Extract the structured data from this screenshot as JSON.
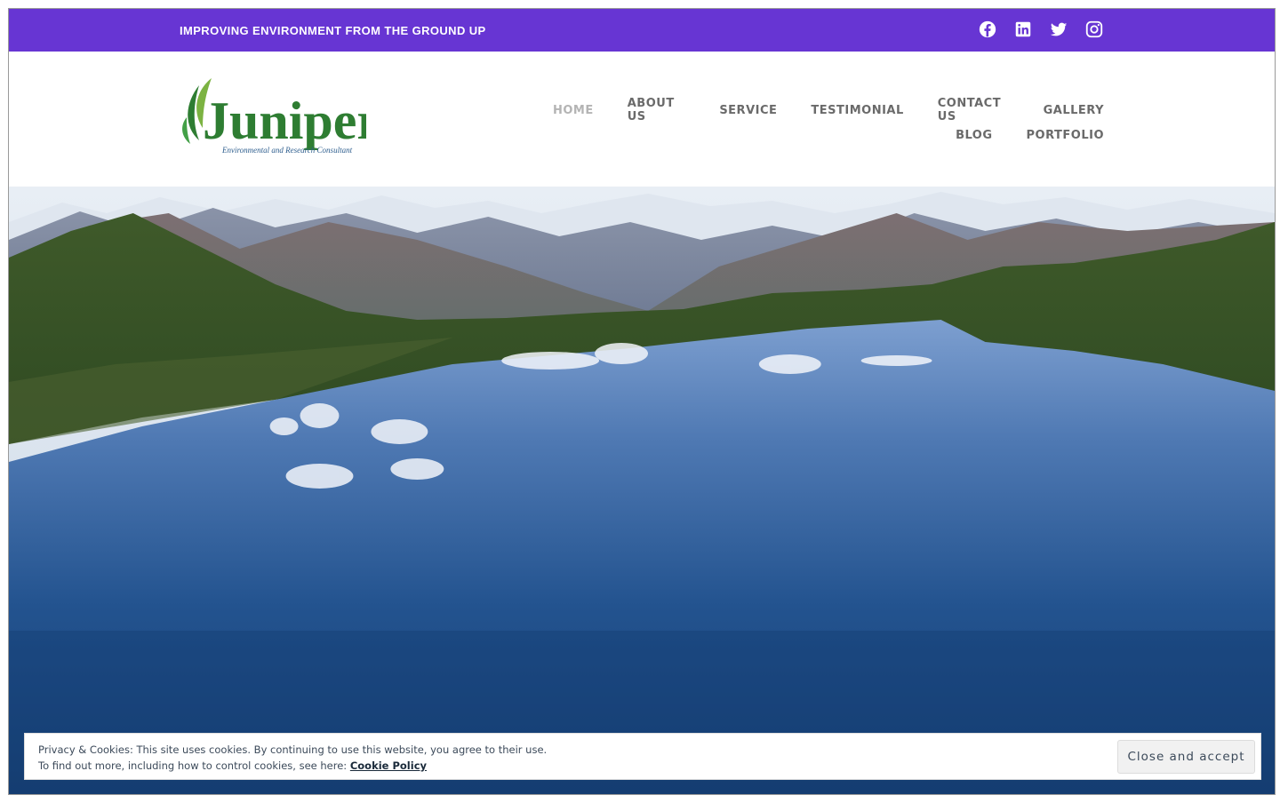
{
  "topbar": {
    "tagline": "IMPROVING ENVIRONMENT FROM THE GROUND UP",
    "background": "#6735d3",
    "social": [
      {
        "icon": "facebook-icon"
      },
      {
        "icon": "linkedin-icon"
      },
      {
        "icon": "twitter-icon"
      },
      {
        "icon": "instagram-icon"
      }
    ]
  },
  "logo": {
    "name": "Juniper",
    "subtitle": "Environmental and Research Consultant",
    "brand_color": "#2e7d32"
  },
  "nav": {
    "row1": [
      "HOME",
      "ABOUT US",
      "SERVICE",
      "TESTIMONIAL",
      "CONTACT US",
      "GALLERY"
    ],
    "row2": [
      "BLOG",
      "PORTFOLIO"
    ],
    "active": "HOME"
  },
  "hero": {
    "image": "mountain-lake-landscape"
  },
  "cookie": {
    "line1": "Privacy & Cookies: This site uses cookies. By continuing to use this website, you agree to their use.",
    "line2_prefix": "To find out more, including how to control cookies, see here: ",
    "policy_link": "Cookie Policy",
    "button": "Close and accept"
  }
}
